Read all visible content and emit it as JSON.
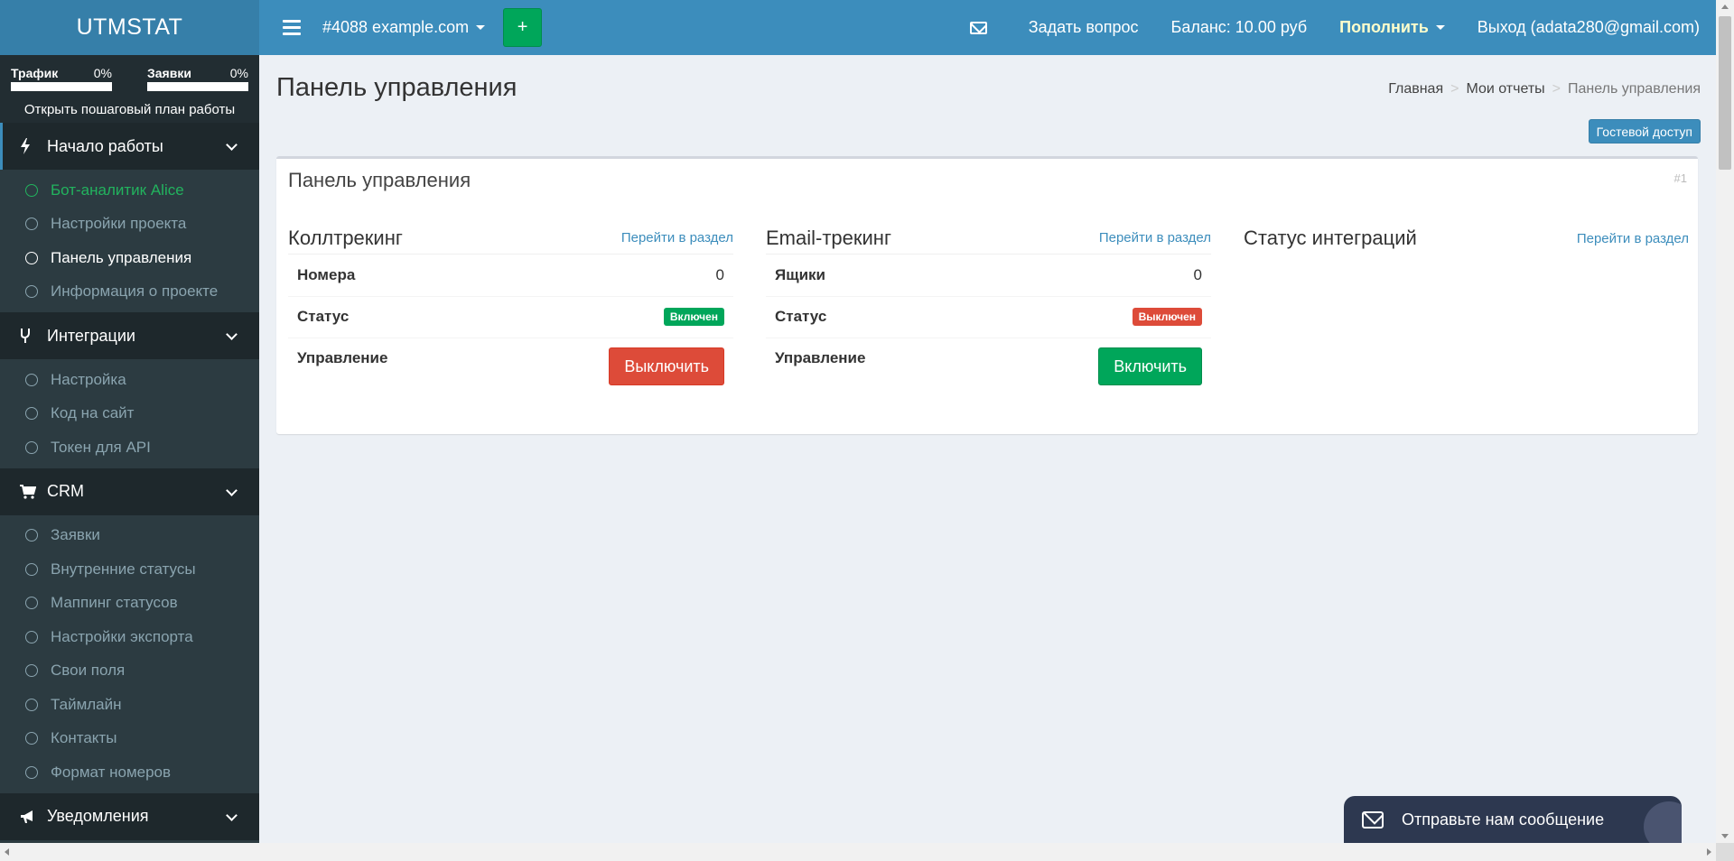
{
  "brand": "UTMSTAT",
  "header": {
    "project": "#4088 example.com",
    "plus": "+",
    "ask": "Задать вопрос",
    "balance": "Баланс: 10.00 руб",
    "topup": "Пополнить",
    "logout": "Выход (adata280@gmail.com)"
  },
  "sidebar": {
    "traffic": {
      "label": "Трафик",
      "pct": "0%",
      "fraction": 0
    },
    "leads": {
      "label": "Заявки",
      "pct": "0%",
      "fraction": 0
    },
    "plan_link": "Открыть пошаговый план работы",
    "sections": [
      {
        "title": "Начало работы",
        "icon": "bolt-icon",
        "items": [
          "Бот-аналитик Alice",
          "Настройки проекта",
          "Панель управления",
          "Информация о проекте"
        ]
      },
      {
        "title": "Интеграции",
        "icon": "fork-icon",
        "items": [
          "Настройка",
          "Код на сайт",
          "Токен для API"
        ]
      },
      {
        "title": "CRM",
        "icon": "cart-icon",
        "items": [
          "Заявки",
          "Внутренние статусы",
          "Маппинг статусов",
          "Настройки экспорта",
          "Свои поля",
          "Таймлайн",
          "Контакты",
          "Формат номеров"
        ]
      },
      {
        "title": "Уведомления",
        "icon": "bullhorn-icon",
        "items": []
      }
    ]
  },
  "page": {
    "title": "Панель управления",
    "breadcrumb": [
      "Главная",
      "Мои отчеты",
      "Панель управления"
    ],
    "guest_btn": "Гостевой доступ"
  },
  "box": {
    "title": "Панель управления",
    "num": "#1",
    "goto": "Перейти в раздел",
    "calltracking": {
      "title": "Коллтрекинг",
      "numbers_label": "Номера",
      "numbers_value": "0",
      "status_label": "Статус",
      "status_value": "Включен",
      "control_label": "Управление",
      "control_btn": "Выключить"
    },
    "email": {
      "title": "Email-трекинг",
      "boxes_label": "Ящики",
      "boxes_value": "0",
      "status_label": "Статус",
      "status_value": "Выключен",
      "control_label": "Управление",
      "control_btn": "Включить"
    },
    "integrations": {
      "title": "Статус интеграций"
    }
  },
  "chat": {
    "label": "Отправьте нам сообщение"
  },
  "colors": {
    "accent": "#3c8dbc",
    "green": "#00a65a",
    "red": "#dd4b39",
    "sidebar": "#222d32"
  }
}
